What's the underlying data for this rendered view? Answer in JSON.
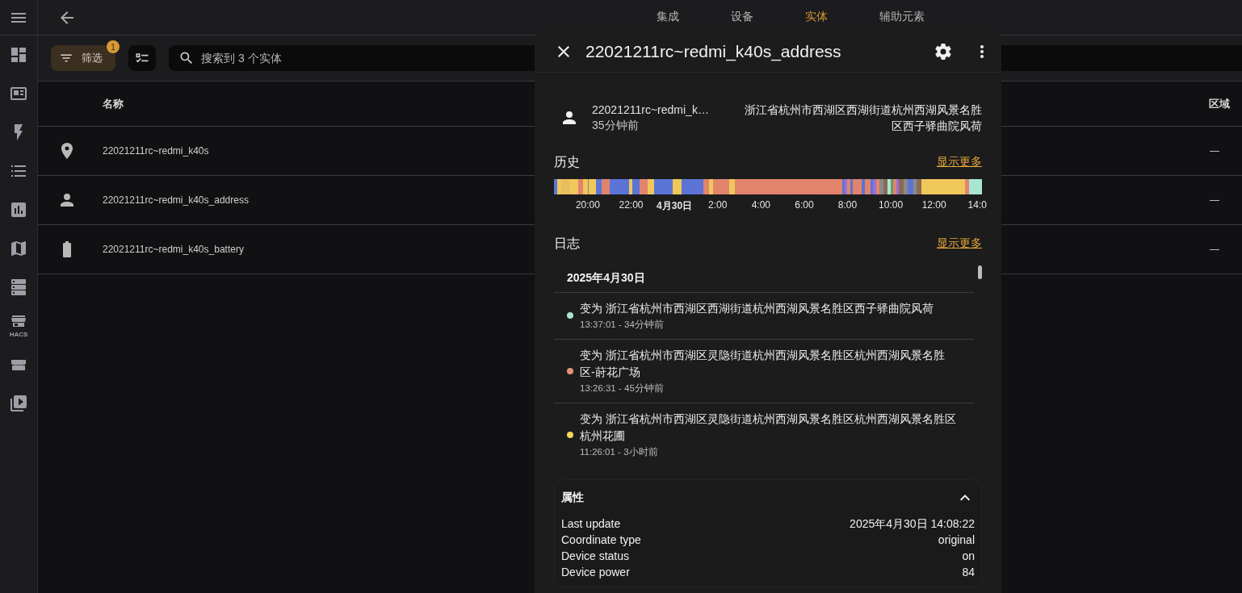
{
  "sidebar": {
    "items": [
      {
        "kind": "dashboard"
      },
      {
        "kind": "logbook"
      },
      {
        "kind": "energy"
      },
      {
        "kind": "todo"
      },
      {
        "kind": "history"
      },
      {
        "kind": "map"
      },
      {
        "kind": "server"
      },
      {
        "kind": "store",
        "caption": "HACS"
      },
      {
        "kind": "market"
      },
      {
        "kind": "media"
      }
    ]
  },
  "top_bar": {
    "tabs": [
      {
        "label": "集成",
        "selected": false
      },
      {
        "label": "设备",
        "selected": false
      },
      {
        "label": "实体",
        "selected": true
      },
      {
        "label": "辅助元素",
        "selected": false
      }
    ]
  },
  "toolbar": {
    "filter_button": {
      "label": "筛选",
      "badge": "1"
    },
    "search": {
      "placeholder": "搜索到 3 个实体"
    }
  },
  "table": {
    "columns": [
      "名称",
      "区域"
    ],
    "rows": [
      {
        "kind": "location",
        "name": "22021211rc~redmi_k40s",
        "area": "—"
      },
      {
        "kind": "person",
        "name": "22021211rc~redmi_k40s_address",
        "area": "—"
      },
      {
        "kind": "battery",
        "name": "22021211rc~redmi_k40s_battery",
        "area": "—"
      }
    ]
  },
  "dialog": {
    "title": "22021211rc~redmi_k40s_address",
    "entity": {
      "name": "22021211rc~redmi_k…",
      "time": "35分钟前",
      "state": "浙江省杭州市西湖区西湖街道杭州西湖风景名胜区西子驿曲院风荷"
    },
    "history": {
      "title": "历史",
      "more_link": "显示更多",
      "ticks": [
        {
          "label": "20:00",
          "kind": "time"
        },
        {
          "label": "22:00",
          "kind": "time"
        },
        {
          "label": "4月30日",
          "kind": "date"
        },
        {
          "label": "2:00",
          "kind": "time"
        },
        {
          "label": "4:00",
          "kind": "time"
        },
        {
          "label": "6:00",
          "kind": "time"
        },
        {
          "label": "8:00",
          "kind": "time"
        },
        {
          "label": "10:00",
          "kind": "time"
        },
        {
          "label": "12:00",
          "kind": "time"
        },
        {
          "label": "14:0",
          "kind": "time"
        }
      ]
    },
    "logbook": {
      "title": "日志",
      "more_link": "显示更多",
      "date": "2025年4月30日",
      "entries": [
        {
          "color": "#a8e6d4",
          "text": "变为 浙江省杭州市西湖区西湖街道杭州西湖风景名胜区西子驿曲院风荷",
          "time": "13:37:01 - 34分钟前"
        },
        {
          "color": "#e8917a",
          "text": "变为 浙江省杭州市西湖区灵隐街道杭州西湖风景名胜区杭州西湖风景名胜区-莳花广场",
          "time": "13:26:31 - 45分钟前"
        },
        {
          "color": "#f3d55b",
          "text": "变为 浙江省杭州市西湖区灵隐街道杭州西湖风景名胜区杭州西湖风景名胜区杭州花圃",
          "time": "11:26:01 - 3小时前"
        }
      ]
    },
    "attributes": {
      "title": "属性",
      "expanded": true,
      "items": [
        {
          "key": "Last update",
          "value": "2025年4月30日 14:08:22"
        },
        {
          "key": "Coordinate type",
          "value": "original"
        },
        {
          "key": "Device status",
          "value": "on"
        },
        {
          "key": "Device power",
          "value": "84"
        }
      ]
    }
  }
}
